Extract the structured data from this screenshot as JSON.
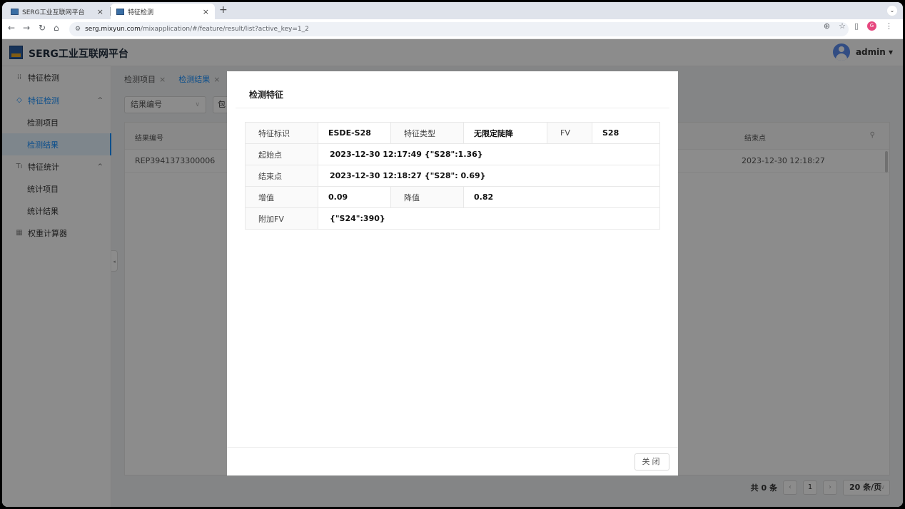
{
  "browser": {
    "tabs": [
      {
        "title": "SERG工业互联网平台",
        "active": false
      },
      {
        "title": "特征检测",
        "active": true
      }
    ],
    "address_host": "serg.mixyun.com",
    "address_path": "/mixapplication/#/feature/result/list?active_key=1_2",
    "profile_initial": "G"
  },
  "header": {
    "app_title": "SERG工业互联网平台",
    "username": "admin ▾"
  },
  "sidebar": {
    "items": [
      {
        "label": "特征检测",
        "icon": "grid-icon"
      },
      {
        "label": "特征检测",
        "icon": "drop-icon",
        "expand": "^"
      },
      {
        "label": "检测项目"
      },
      {
        "label": "检测结果"
      },
      {
        "label": "特征统计",
        "icon": "text-icon",
        "expand": "^"
      },
      {
        "label": "统计项目"
      },
      {
        "label": "统计结果"
      },
      {
        "label": "权重计算器",
        "icon": "calculator-icon"
      }
    ]
  },
  "page": {
    "tabs": [
      "检测项目",
      "检测结果"
    ],
    "filter_label": "结果编号",
    "filter2_label": "包",
    "table": {
      "headers": [
        "结果编号",
        "结束点"
      ],
      "rows": [
        [
          "REP3941373300006",
          "2023-12-30 12:18:27"
        ]
      ]
    },
    "pager": {
      "total": "共 0 条",
      "current_page": "1",
      "page_size": "20 条/页"
    }
  },
  "modal": {
    "title": "检测特征",
    "row1": {
      "l1": "特征标识",
      "v1": "ESDE-S28",
      "l2": "特征类型",
      "v2": "无限定陡降",
      "l3": "FV",
      "v3": "S28"
    },
    "row2": {
      "l": "起始点",
      "v": "2023-12-30 12:17:49  {\"S28\":1.36}"
    },
    "row3": {
      "l": "结束点",
      "v": "2023-12-30 12:18:27  {\"S28\": 0.69}"
    },
    "row4": {
      "l1": "增值",
      "v1": "0.09",
      "l2": "降值",
      "v2": "0.82"
    },
    "row5": {
      "l": "附加FV",
      "v": "{\"S24\":390}"
    },
    "close_label": "关闭"
  }
}
